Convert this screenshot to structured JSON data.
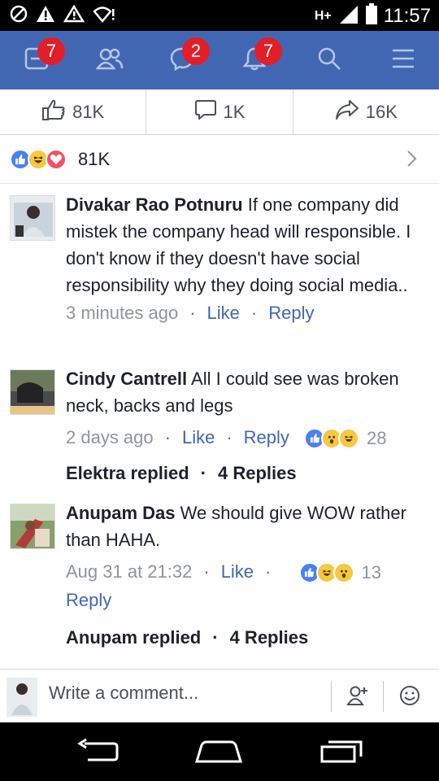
{
  "status_bar": {
    "network": "H+",
    "time": "11:57"
  },
  "nav": {
    "home_badge": "7",
    "messages_badge": "2",
    "notifications_badge": "7"
  },
  "stats": {
    "likes": "81K",
    "comments": "1K",
    "shares": "16K"
  },
  "reactions_summary": {
    "total": "81K"
  },
  "comments": [
    {
      "author": "Divakar Rao Potnuru",
      "text": " If one company did mistek the company head will responsible. I don't know if they doesn't have social responsibility why they doing social media..",
      "time": "3 minutes ago",
      "like_label": "Like",
      "reply_label": "Reply"
    },
    {
      "author": "Cindy Cantrell",
      "text": " All I could see was broken neck, backs and legs",
      "time": "2 days ago",
      "like_label": "Like",
      "reply_label": "Reply",
      "reaction_count": "28",
      "replied_by": "Elektra replied",
      "replies": "4 Replies"
    },
    {
      "author": "Anupam Das",
      "text": " We should give WOW rather than HAHA.",
      "time": "Aug 31 at 21:32",
      "like_label": "Like",
      "reply_label": "Reply",
      "reaction_count": "13",
      "replied_by": "Anupam replied",
      "replies": "4 Replies"
    }
  ],
  "composer": {
    "placeholder": "Write a comment..."
  },
  "colors": {
    "brand_blue": "#4267b2",
    "badge_red": "#e41e26",
    "meta_gray": "#90949c",
    "text_dark": "#1d2129"
  }
}
